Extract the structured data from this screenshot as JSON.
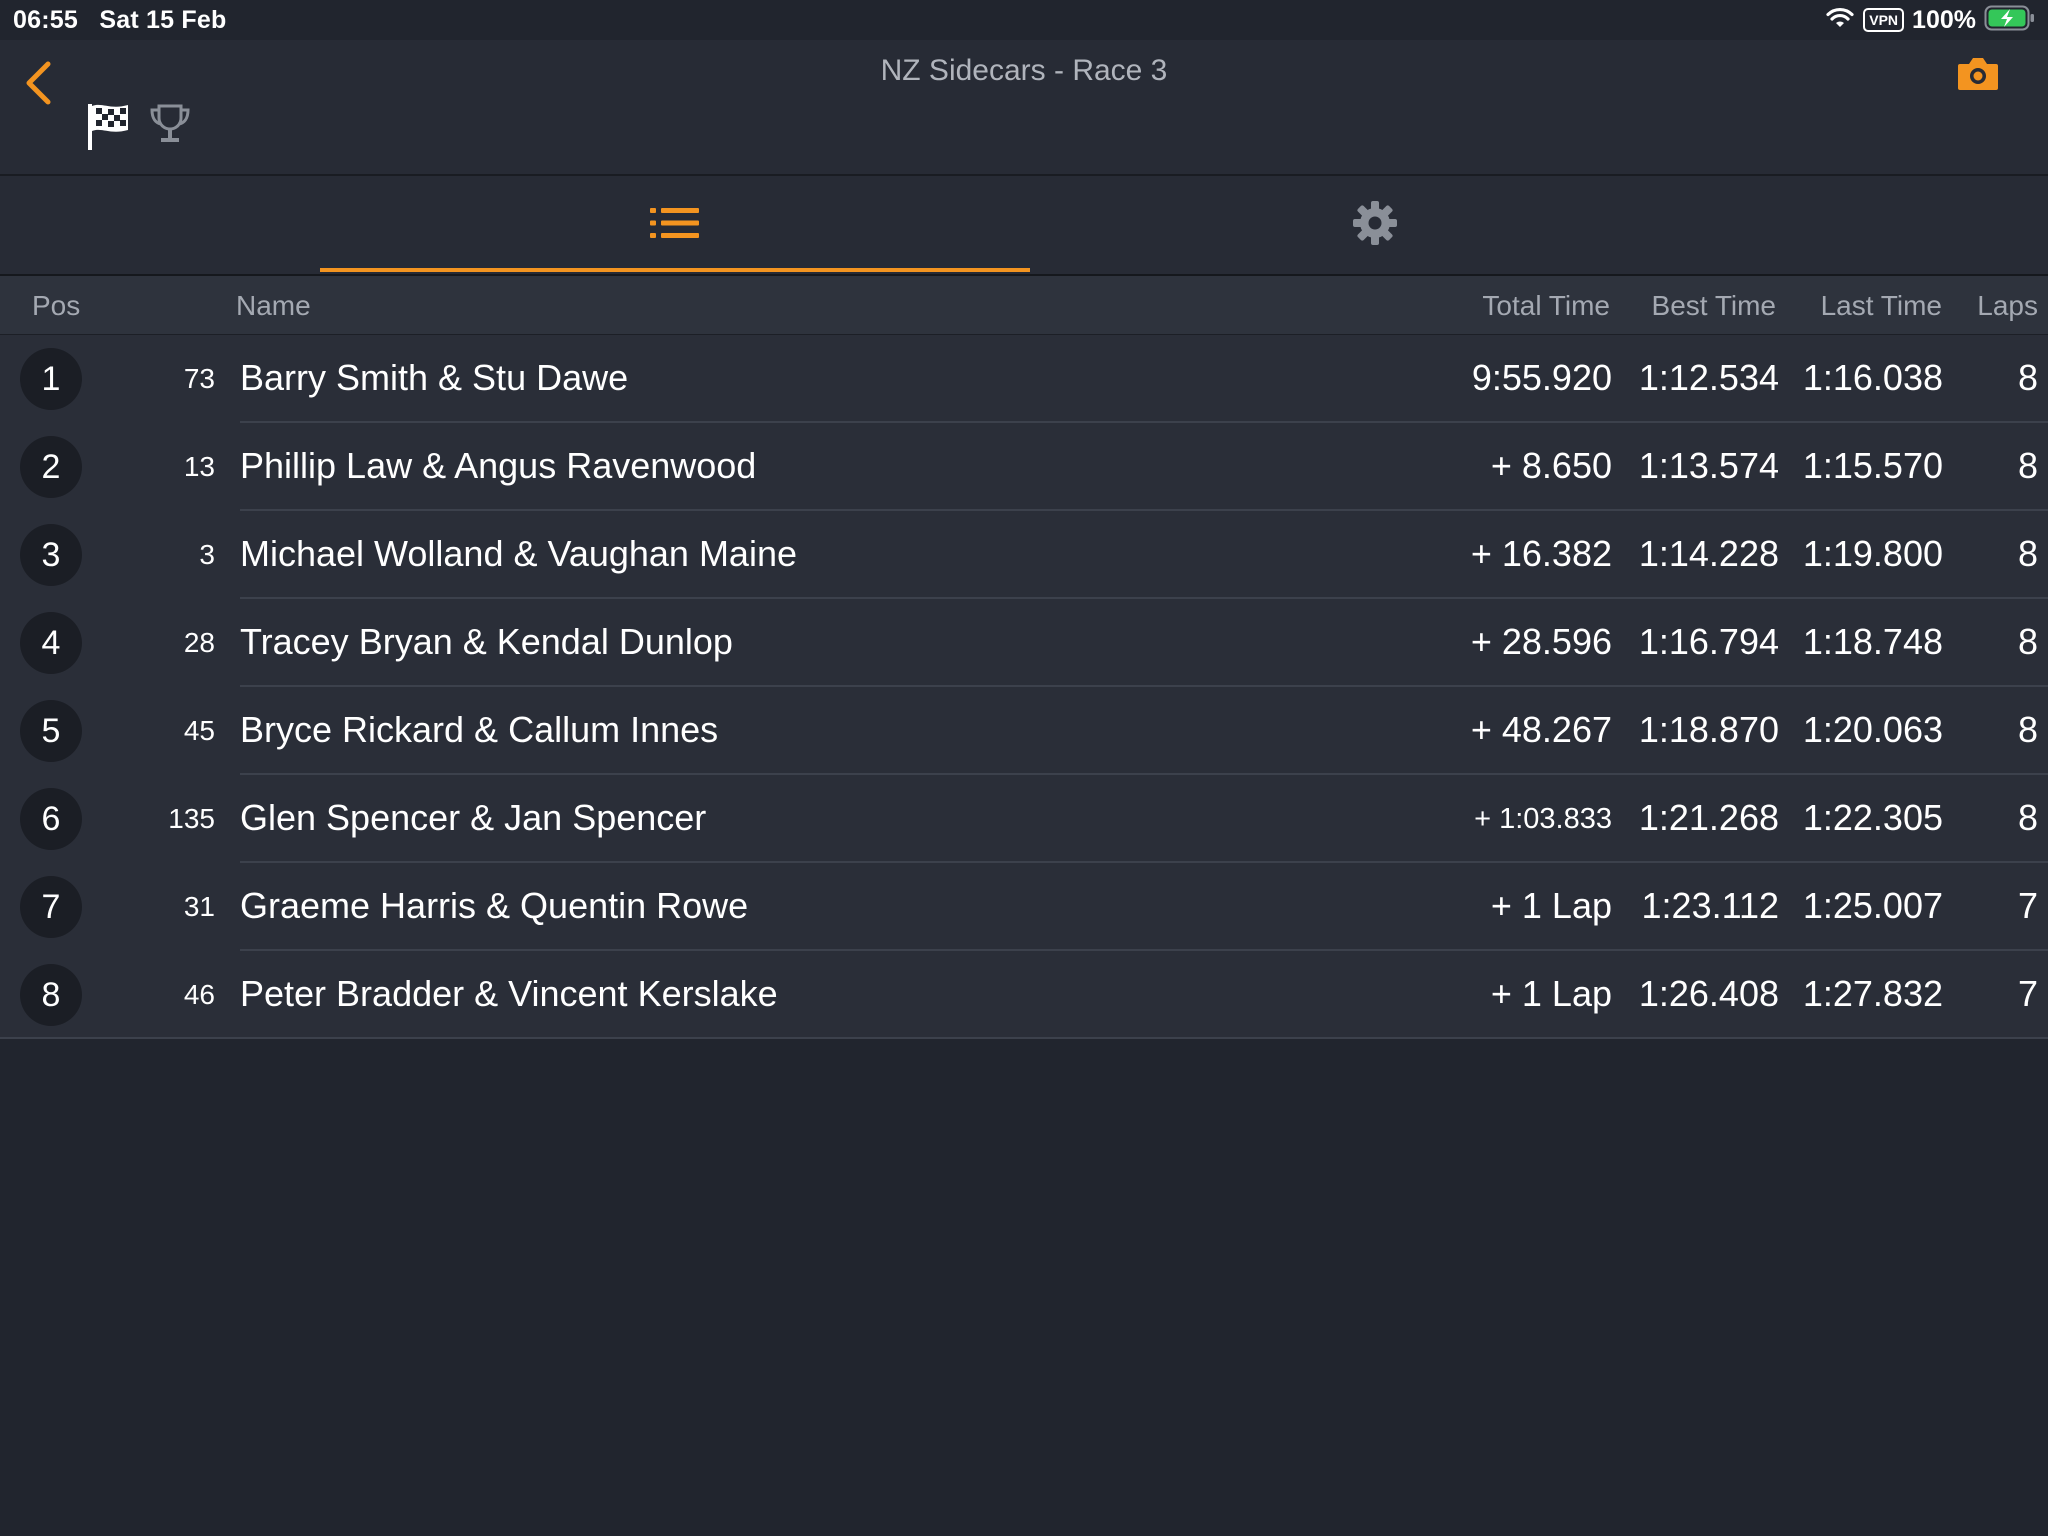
{
  "status_bar": {
    "time": "06:55",
    "date": "Sat 15 Feb",
    "vpn": "VPN",
    "battery": "100%"
  },
  "header": {
    "title": "NZ Sidecars - Race 3"
  },
  "colors": {
    "accent": "#f39420",
    "background": "#21252e",
    "row": "#2a2e38",
    "header_row": "#2e333d"
  },
  "icons": {
    "back": "chevron-left-icon",
    "flag": "checkered-flag-icon",
    "trophy": "trophy-icon",
    "camera": "camera-icon",
    "list": "list-icon",
    "settings": "gear-icon"
  },
  "tabs": {
    "active": "list"
  },
  "columns": {
    "pos": "Pos",
    "name": "Name",
    "total": "Total Time",
    "best": "Best Time",
    "last": "Last Time",
    "laps": "Laps"
  },
  "rows": [
    {
      "pos": "1",
      "num": "73",
      "name": "Barry Smith & Stu Dawe",
      "total": "9:55.920",
      "best": "1:12.534",
      "last": "1:16.038",
      "laps": "8"
    },
    {
      "pos": "2",
      "num": "13",
      "name": "Phillip Law & Angus Ravenwood",
      "total": "+ 8.650",
      "best": "1:13.574",
      "last": "1:15.570",
      "laps": "8"
    },
    {
      "pos": "3",
      "num": "3",
      "name": "Michael Wolland & Vaughan Maine",
      "total": "+ 16.382",
      "best": "1:14.228",
      "last": "1:19.800",
      "laps": "8"
    },
    {
      "pos": "4",
      "num": "28",
      "name": "Tracey Bryan & Kendal Dunlop",
      "total": "+ 28.596",
      "best": "1:16.794",
      "last": "1:18.748",
      "laps": "8"
    },
    {
      "pos": "5",
      "num": "45",
      "name": "Bryce Rickard & Callum Innes",
      "total": "+ 48.267",
      "best": "1:18.870",
      "last": "1:20.063",
      "laps": "8"
    },
    {
      "pos": "6",
      "num": "135",
      "name": "Glen Spencer & Jan Spencer",
      "total": "+ 1:03.833",
      "best": "1:21.268",
      "last": "1:22.305",
      "laps": "8"
    },
    {
      "pos": "7",
      "num": "31",
      "name": "Graeme Harris & Quentin Rowe",
      "total": "+ 1 Lap",
      "best": "1:23.112",
      "last": "1:25.007",
      "laps": "7"
    },
    {
      "pos": "8",
      "num": "46",
      "name": "Peter Bradder & Vincent Kerslake",
      "total": "+ 1 Lap",
      "best": "1:26.408",
      "last": "1:27.832",
      "laps": "7"
    }
  ]
}
